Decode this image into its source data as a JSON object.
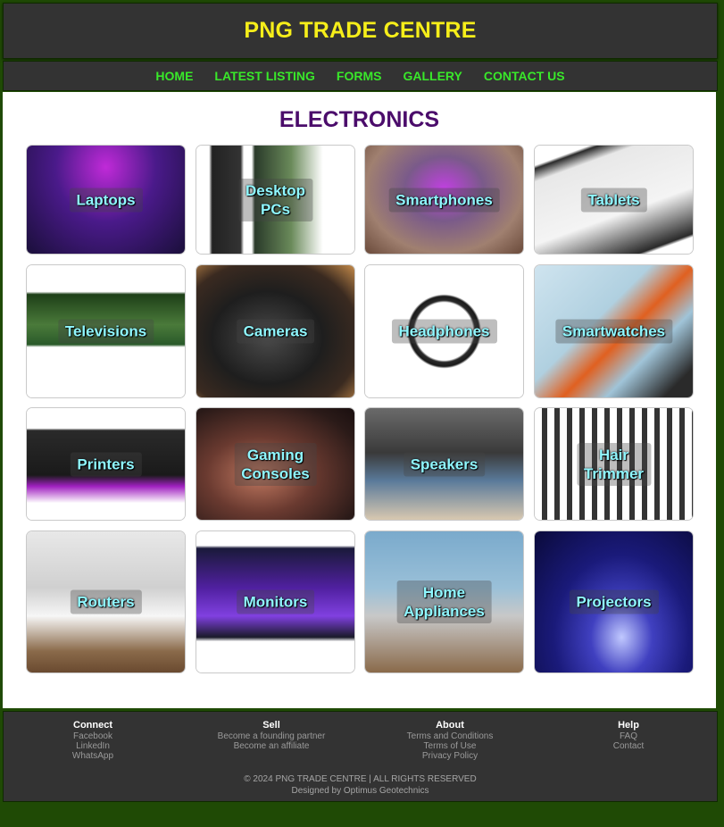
{
  "site_title": "PNG TRADE CENTRE",
  "nav": [
    "HOME",
    "LATEST LISTING",
    "FORMS",
    "GALLERY",
    "CONTACT US"
  ],
  "page_title": "ELECTRONICS",
  "categories": [
    "Laptops",
    "Desktop\nPCs",
    "Smartphones",
    "Tablets",
    "Televisions",
    "Cameras",
    "Headphones",
    "Smartwatches",
    "Printers",
    "Gaming\nConsoles",
    "Speakers",
    "Hair\nTrimmer",
    "Routers",
    "Monitors",
    "Home\nAppliances",
    "Projectors"
  ],
  "footer": {
    "connect": {
      "title": "Connect",
      "links": [
        "Facebook",
        "LinkedIn",
        "WhatsApp"
      ]
    },
    "sell": {
      "title": "Sell",
      "links": [
        "Become a founding partner",
        "Become an affiliate"
      ]
    },
    "about": {
      "title": "About",
      "links": [
        "Terms and Conditions",
        "Terms of Use",
        "Privacy Policy"
      ]
    },
    "help": {
      "title": "Help",
      "links": [
        "FAQ",
        "Contact"
      ]
    },
    "copyright": "© 2024 PNG TRADE CENTRE | ALL RIGHTS RESERVED",
    "credit": "Designed by Optimus Geotechnics"
  },
  "colors": {
    "page_bg": "#1f4a05",
    "bar_bg": "#333333",
    "title_yellow": "#f6ee1a",
    "nav_green": "#39e82a",
    "heading_purple": "#4b0c6b",
    "card_label": "#8ff7ff"
  }
}
